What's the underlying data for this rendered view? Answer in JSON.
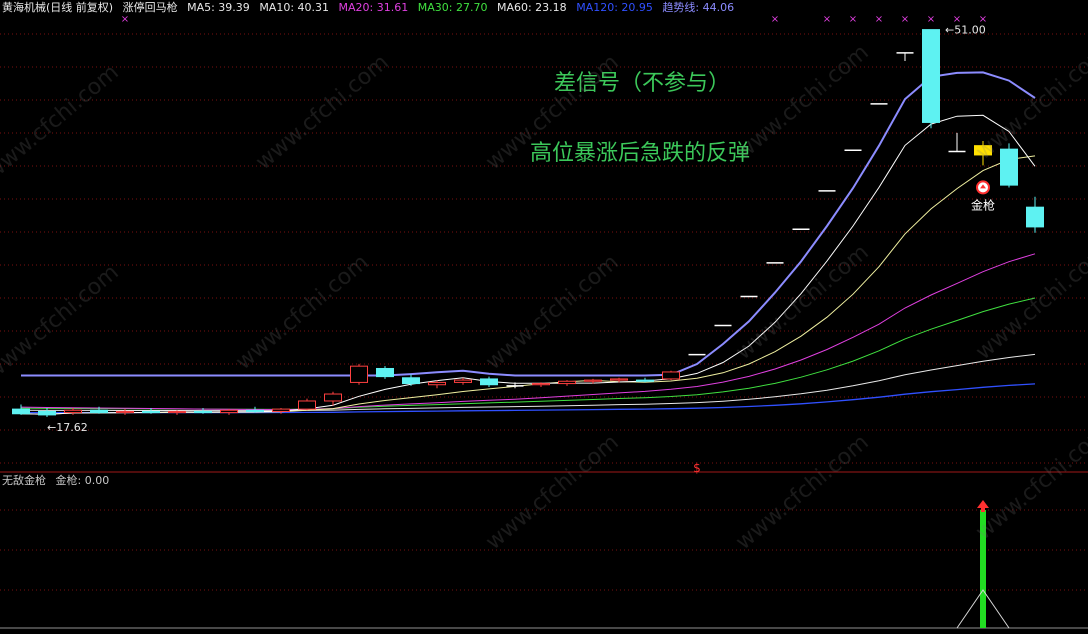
{
  "header": {
    "stock": "黄海机械(日线 前复权)",
    "formula": "涨停回马枪",
    "indicators": [
      {
        "label": "MA5: 39.39",
        "color": "#e8e8e8"
      },
      {
        "label": "MA10: 40.31",
        "color": "#e8e8e8"
      },
      {
        "label": "MA20: 31.61",
        "color": "#e040e0"
      },
      {
        "label": "MA30: 27.70",
        "color": "#40e040"
      },
      {
        "label": "MA60: 23.18",
        "color": "#e8e8e8"
      },
      {
        "label": "MA120: 20.95",
        "color": "#3050ff"
      },
      {
        "label": "趋势线: 44.06",
        "color": "#8c8cff"
      }
    ]
  },
  "sub_header": {
    "name": "无敌金枪",
    "value_label": "金枪: 0.00"
  },
  "annotations": {
    "line1": "差信号（不参与）",
    "line2": "高位暴涨后急跌的反弹",
    "signal_label": "金枪"
  },
  "price_labels": {
    "high": "51.00",
    "low": "17.62"
  },
  "watermark": "www.cfchi.com",
  "colors": {
    "grid": "#7a1010",
    "up_candle": "#ff4040",
    "down_candle": "#5ef2f2",
    "doji": "#ffffff",
    "yellow_candle": "#ffe000",
    "trend_line": "#8c8cff",
    "ma5": "#ffffff",
    "ma10": "#f0f0a0",
    "ma20": "#e040e0",
    "ma30": "#40e040",
    "ma60": "#e8e8e8",
    "ma120": "#3050ff",
    "signal_bar": "#22dd22",
    "marker": "#e040e0"
  },
  "chart_data": {
    "type": "candlestick",
    "price_range": [
      16.5,
      52.0
    ],
    "candles": [
      {
        "o": 18.3,
        "h": 18.7,
        "l": 17.8,
        "c": 17.9
      },
      {
        "o": 18.1,
        "h": 18.4,
        "l": 17.62,
        "c": 17.8
      },
      {
        "o": 18.0,
        "h": 18.4,
        "l": 17.8,
        "c": 18.2
      },
      {
        "o": 18.2,
        "h": 18.5,
        "l": 17.9,
        "c": 18.0
      },
      {
        "o": 18.0,
        "h": 18.3,
        "l": 17.8,
        "c": 18.1
      },
      {
        "o": 18.1,
        "h": 18.4,
        "l": 17.9,
        "c": 18.0
      },
      {
        "o": 18.0,
        "h": 18.2,
        "l": 17.8,
        "c": 18.1
      },
      {
        "o": 18.1,
        "h": 18.4,
        "l": 17.9,
        "c": 18.0
      },
      {
        "o": 18.0,
        "h": 18.3,
        "l": 17.8,
        "c": 18.2
      },
      {
        "o": 18.2,
        "h": 18.5,
        "l": 18.0,
        "c": 18.1
      },
      {
        "o": 18.1,
        "h": 18.4,
        "l": 17.9,
        "c": 18.3
      },
      {
        "o": 18.3,
        "h": 19.2,
        "l": 18.2,
        "c": 19.0
      },
      {
        "o": 19.0,
        "h": 19.8,
        "l": 18.6,
        "c": 19.6
      },
      {
        "o": 20.6,
        "h": 22.2,
        "l": 20.4,
        "c": 22.0
      },
      {
        "o": 21.8,
        "h": 22.0,
        "l": 20.9,
        "c": 21.1
      },
      {
        "o": 21.0,
        "h": 21.3,
        "l": 20.3,
        "c": 20.5
      },
      {
        "o": 20.4,
        "h": 20.8,
        "l": 20.1,
        "c": 20.6
      },
      {
        "o": 20.6,
        "h": 21.0,
        "l": 20.4,
        "c": 20.8
      },
      {
        "o": 20.9,
        "h": 21.1,
        "l": 20.2,
        "c": 20.4
      },
      {
        "o": 20.3,
        "h": 20.6,
        "l": 20.1,
        "c": 20.3
      },
      {
        "o": 20.4,
        "h": 20.6,
        "l": 20.2,
        "c": 20.5
      },
      {
        "o": 20.5,
        "h": 20.8,
        "l": 20.3,
        "c": 20.7
      },
      {
        "o": 20.7,
        "h": 20.9,
        "l": 20.5,
        "c": 20.8
      },
      {
        "o": 20.8,
        "h": 21.0,
        "l": 20.6,
        "c": 20.9
      },
      {
        "o": 20.8,
        "h": 21.0,
        "l": 20.6,
        "c": 20.7
      },
      {
        "o": 20.9,
        "h": 21.6,
        "l": 20.8,
        "c": 21.5
      },
      {
        "o": 23.0,
        "h": 23.0,
        "l": 23.0,
        "c": 23.0
      },
      {
        "o": 25.5,
        "h": 25.5,
        "l": 25.5,
        "c": 25.5
      },
      {
        "o": 28.0,
        "h": 28.0,
        "l": 28.0,
        "c": 28.0
      },
      {
        "o": 30.9,
        "h": 30.9,
        "l": 30.9,
        "c": 30.9
      },
      {
        "o": 33.8,
        "h": 33.8,
        "l": 33.8,
        "c": 33.8
      },
      {
        "o": 37.1,
        "h": 37.1,
        "l": 37.1,
        "c": 37.1
      },
      {
        "o": 40.6,
        "h": 40.6,
        "l": 40.6,
        "c": 40.6
      },
      {
        "o": 44.6,
        "h": 44.6,
        "l": 44.6,
        "c": 44.6
      },
      {
        "o": 49.0,
        "h": 49.0,
        "l": 48.3,
        "c": 49.0
      },
      {
        "o": 51.0,
        "h": 51.0,
        "l": 42.5,
        "c": 43.0
      },
      {
        "o": 40.5,
        "h": 42.1,
        "l": 40.5,
        "c": 40.5
      },
      {
        "o": 40.2,
        "h": 41.4,
        "l": 39.3,
        "c": 41.0
      },
      {
        "o": 40.7,
        "h": 41.2,
        "l": 37.4,
        "c": 37.6
      },
      {
        "o": 35.7,
        "h": 36.6,
        "l": 33.5,
        "c": 34.0
      }
    ],
    "signal": {
      "candle_index": 37,
      "value": 1.0
    },
    "markers_candle_indices": [
      4,
      29,
      31,
      32,
      33,
      34,
      35,
      36,
      37
    ]
  }
}
